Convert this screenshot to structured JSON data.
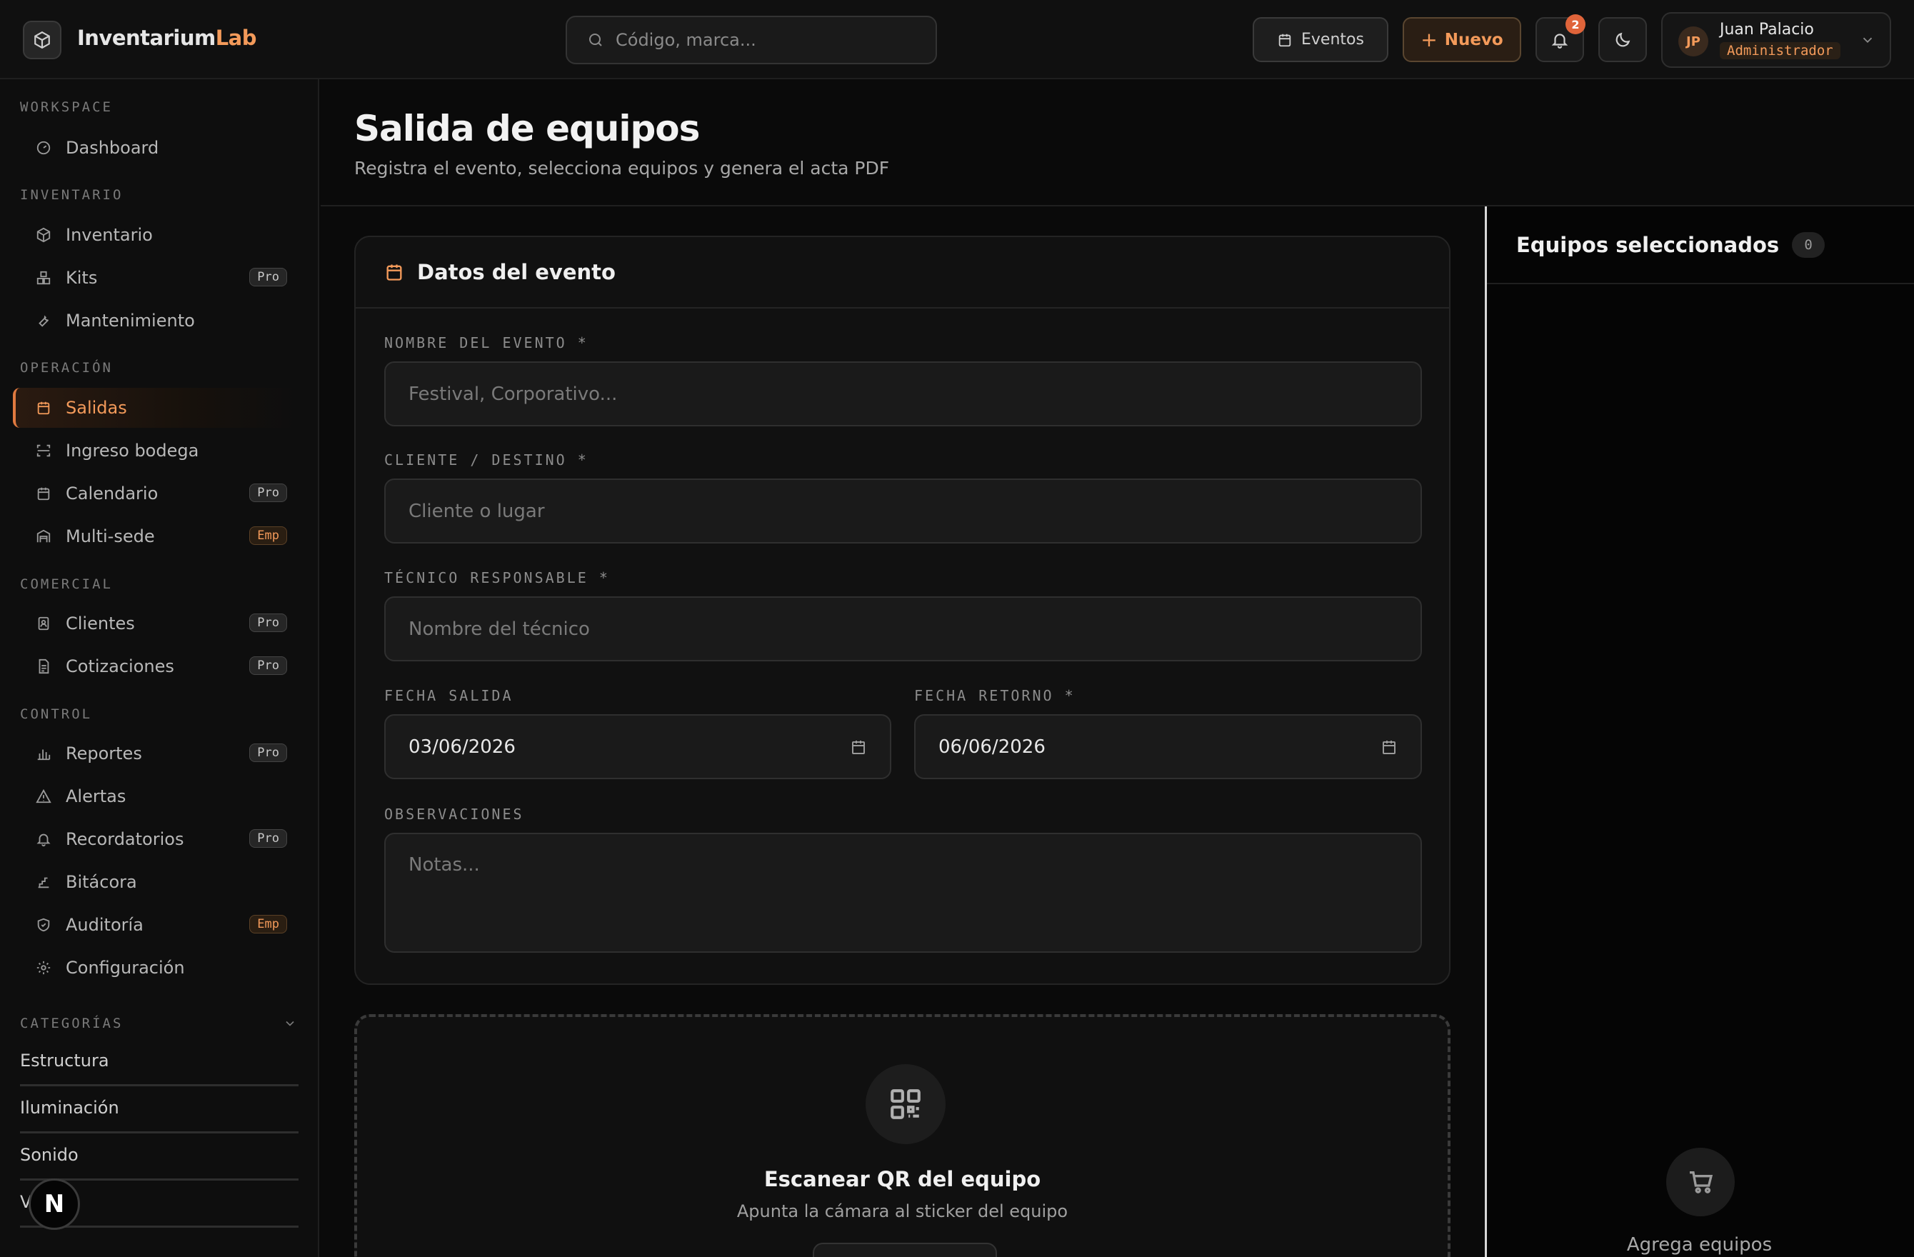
{
  "brand": {
    "name_main": "Inventarium",
    "name_accent": "Lab"
  },
  "search": {
    "placeholder": "Código, marca..."
  },
  "header_actions": {
    "eventos": "Eventos",
    "nuevo": "Nuevo",
    "notifications": "2"
  },
  "user": {
    "initials": "JP",
    "name": "Juan Palacio",
    "role": "Administrador"
  },
  "sidebar": {
    "sections": {
      "workspace": "WORKSPACE",
      "inventario": "INVENTARIO",
      "operacion": "OPERACIÓN",
      "comercial": "COMERCIAL",
      "control": "CONTROL",
      "categorias": "CATEGORÍAS"
    },
    "items": {
      "dashboard": "Dashboard",
      "inventario": "Inventario",
      "kits": "Kits",
      "mantenimiento": "Mantenimiento",
      "salidas": "Salidas",
      "ingreso": "Ingreso bodega",
      "calendario": "Calendario",
      "multisede": "Multi-sede",
      "clientes": "Clientes",
      "cotizaciones": "Cotizaciones",
      "reportes": "Reportes",
      "alertas": "Alertas",
      "recordatorios": "Recordatorios",
      "bitacora": "Bitácora",
      "auditoria": "Auditoría",
      "configuracion": "Configuración"
    },
    "badges": {
      "pro": "Pro",
      "emp": "Emp"
    },
    "categories": [
      "Estructura",
      "Iluminación",
      "Sonido",
      "V"
    ]
  },
  "page": {
    "title": "Salida de equipos",
    "subtitle": "Registra el evento, selecciona equipos y genera el acta PDF"
  },
  "form": {
    "card_title": "Datos del evento",
    "event_name": {
      "label": "NOMBRE DEL EVENTO *",
      "placeholder": "Festival, Corporativo..."
    },
    "client": {
      "label": "CLIENTE / DESTINO *",
      "placeholder": "Cliente o lugar"
    },
    "tech": {
      "label": "TÉCNICO RESPONSABLE *",
      "placeholder": "Nombre del técnico"
    },
    "date_out": {
      "label": "FECHA SALIDA",
      "value": "03/06/2026"
    },
    "date_return": {
      "label": "FECHA RETORNO *",
      "value": "06/06/2026"
    },
    "notes": {
      "label": "OBSERVACIONES",
      "placeholder": "Notas..."
    }
  },
  "qr": {
    "title": "Escanear QR del equipo",
    "subtitle": "Apunta la cámara al sticker del equipo"
  },
  "selected": {
    "title": "Equipos seleccionados",
    "count": "0",
    "empty": "Agrega equipos"
  },
  "fab": {
    "label": "N"
  },
  "colors": {
    "accent": "#f39a5a",
    "background": "#0a0a0a",
    "panel": "#111111"
  }
}
